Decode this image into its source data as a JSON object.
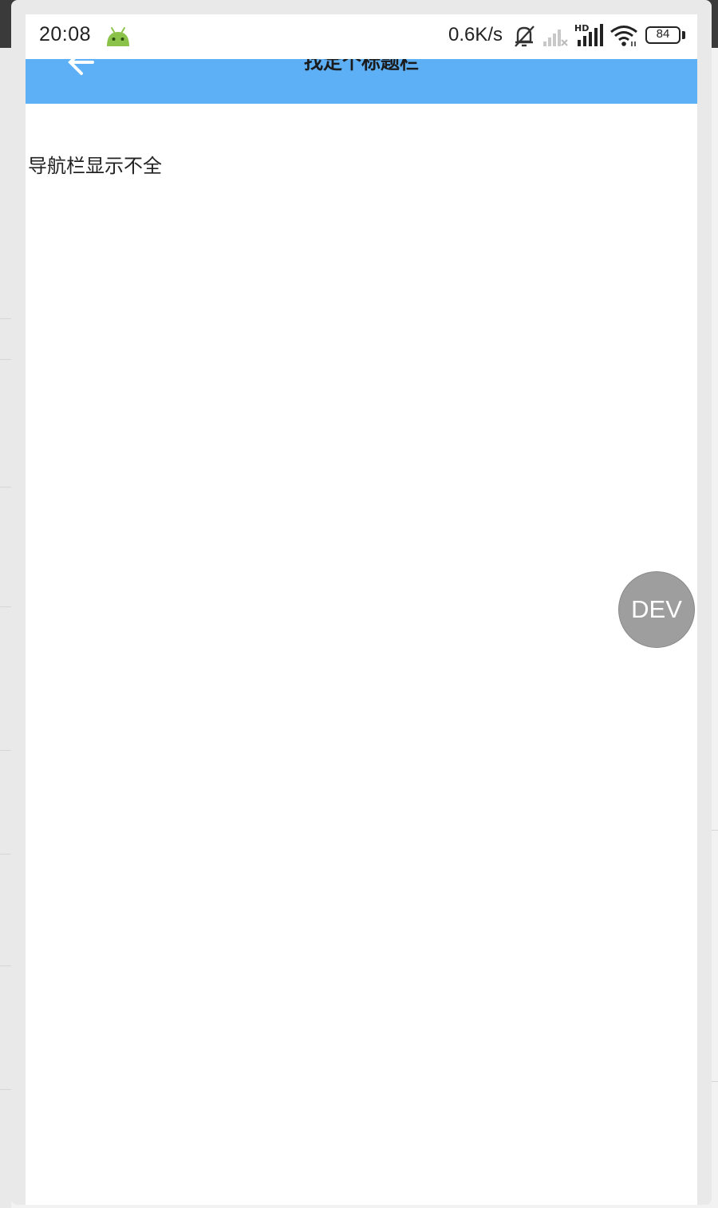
{
  "status_bar": {
    "time": "20:08",
    "network_speed": "0.6K/s",
    "battery_level": "84",
    "icons": [
      "android-icon",
      "mute-bell-icon",
      "signal-weak-icon",
      "hd-signal-icon",
      "wifi-icon",
      "battery-icon"
    ]
  },
  "title_bar": {
    "title": "找定个标题栏",
    "background_color": "#5eb0f6",
    "back_icon": "back-arrow-icon"
  },
  "content": {
    "text": "导航栏显示不全"
  },
  "floating_button": {
    "label": "DEV",
    "color": "#9e9e9e"
  }
}
